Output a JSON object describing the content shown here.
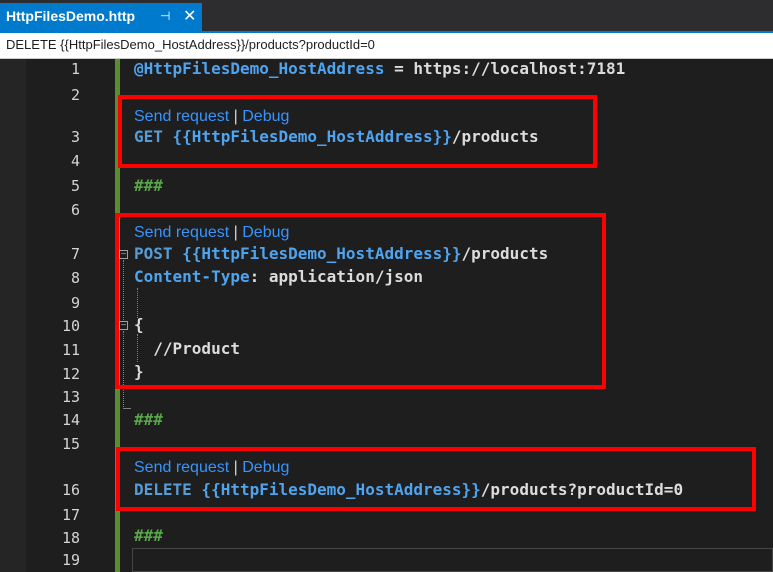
{
  "tab": {
    "title": "HttpFilesDemo.http",
    "pin_icon": "pin-icon",
    "close_icon": "close-icon"
  },
  "navbar": {
    "text": "DELETE {{HttpFilesDemo_HostAddress}}/products?productId=0"
  },
  "line_numbers": [
    "1",
    "2",
    "3",
    "4",
    "5",
    "6",
    "7",
    "8",
    "9",
    "10",
    "11",
    "12",
    "13",
    "14",
    "15",
    "16",
    "17",
    "18",
    "19"
  ],
  "code": {
    "l1_var": "@HttpFilesDemo_HostAddress",
    "l1_rest": " = https://localhost:7181",
    "l3_method": "GET",
    "l3_var": " {{HttpFilesDemo_HostAddress}}",
    "l3_path": "/products",
    "l5_sep": "###",
    "l7_method": "POST",
    "l7_var": " {{HttpFilesDemo_HostAddress}}",
    "l7_path": "/products",
    "l8_header": "Content-Type",
    "l8_rest": ": application/json",
    "l10_brace": "{",
    "l11_comment": "  //Product",
    "l12_brace": "}",
    "l14_sep": "###",
    "l16_method": "DELETE",
    "l16_var": " {{HttpFilesDemo_HostAddress}}",
    "l16_path": "/products?productId=0",
    "l18_sep": "###"
  },
  "codelens": {
    "send": "Send request",
    "divider": "|",
    "debug": "Debug"
  },
  "colors": {
    "tab_accent": "#007acc",
    "highlight_box": "#ff0000",
    "link": "#3794ff",
    "change_bar": "#5b8c31"
  }
}
